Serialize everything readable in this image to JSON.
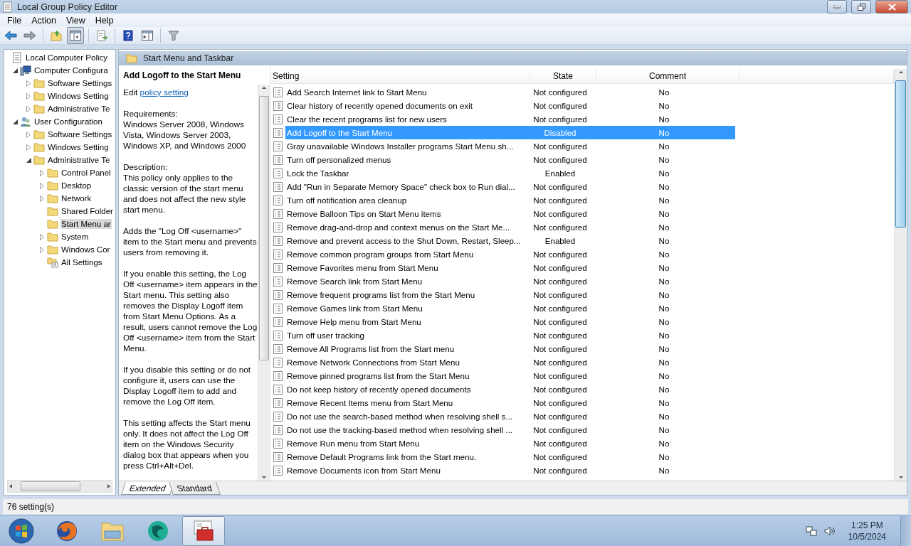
{
  "window": {
    "title": "Local Group Policy Editor"
  },
  "menu": [
    "File",
    "Action",
    "View",
    "Help"
  ],
  "toolbar": [
    {
      "kind": "back",
      "pressed": false
    },
    {
      "kind": "forward",
      "pressed": false
    },
    {
      "kind": "up",
      "pressed": false
    },
    {
      "kind": "tree",
      "pressed": true
    },
    {
      "kind": "export",
      "pressed": false
    },
    {
      "kind": "help",
      "pressed": false
    },
    {
      "kind": "action-pane",
      "pressed": false
    },
    {
      "kind": "filter",
      "pressed": false
    }
  ],
  "tree": [
    {
      "label": "Local Computer Policy",
      "kind": "policy",
      "selected": false,
      "children": [
        {
          "label": "Computer Configura",
          "kind": "computer",
          "selected": false,
          "expanded": true,
          "children": [
            {
              "label": "Software Settings",
              "kind": "folder",
              "selected": false,
              "expanded": false
            },
            {
              "label": "Windows Setting",
              "kind": "folder",
              "selected": false,
              "expanded": false
            },
            {
              "label": "Administrative Te",
              "kind": "folder",
              "selected": false,
              "expanded": false
            }
          ]
        },
        {
          "label": "User Configuration",
          "kind": "users",
          "selected": false,
          "expanded": true,
          "children": [
            {
              "label": "Software Settings",
              "kind": "folder",
              "selected": false,
              "expanded": false
            },
            {
              "label": "Windows Setting",
              "kind": "folder",
              "selected": false,
              "expanded": false
            },
            {
              "label": "Administrative Te",
              "kind": "folder",
              "selected": false,
              "expanded": true,
              "children": [
                {
                  "label": "Control Panel",
                  "kind": "folder",
                  "selected": false,
                  "expanded": false
                },
                {
                  "label": "Desktop",
                  "kind": "folder",
                  "selected": false,
                  "expanded": false
                },
                {
                  "label": "Network",
                  "kind": "folder",
                  "selected": false,
                  "expanded": false
                },
                {
                  "label": "Shared Folder",
                  "kind": "folder",
                  "selected": false
                },
                {
                  "label": "Start Menu ar",
                  "kind": "folder",
                  "selected": true
                },
                {
                  "label": "System",
                  "kind": "folder",
                  "selected": false,
                  "expanded": false
                },
                {
                  "label": "Windows Cor",
                  "kind": "folder",
                  "selected": false,
                  "expanded": false
                },
                {
                  "label": "All Settings",
                  "kind": "all-settings",
                  "selected": false
                }
              ]
            }
          ]
        }
      ]
    }
  ],
  "pane": {
    "title": "Start Menu and Taskbar"
  },
  "description": {
    "title": "Add Logoff to the Start Menu",
    "edit_prefix": "Edit",
    "edit_link": "policy setting",
    "blocks": [
      {
        "heading": "Requirements:",
        "text": "Windows Server 2008, Windows Vista, Windows Server 2003, Windows XP, and Windows 2000"
      },
      {
        "heading": "Description:",
        "text": "This policy only applies to the classic version of the start menu and does not affect the new style start menu."
      },
      {
        "text": "Adds the \"Log Off <username>\" item to the Start menu and prevents users from removing it."
      },
      {
        "text": "If you enable this setting, the Log Off <username> item appears in the Start menu. This setting also removes the Display Logoff item from Start Menu Options. As a result, users cannot remove the Log Off <username> item from the Start Menu."
      },
      {
        "text": "If you disable this setting or do not configure it, users can use the Display Logoff item to add and remove the Log Off item."
      },
      {
        "text": "This setting affects the Start menu only. It does not affect the Log Off item on the Windows Security dialog box that appears when you press Ctrl+Alt+Del."
      }
    ]
  },
  "table": {
    "columns": [
      "Setting",
      "State",
      "Comment"
    ],
    "rows": [
      {
        "setting": "Add Search Internet link to Start Menu",
        "state": "Not configured",
        "comment": "No",
        "selected": false
      },
      {
        "setting": "Clear history of recently opened documents on exit",
        "state": "Not configured",
        "comment": "No",
        "selected": false
      },
      {
        "setting": "Clear the recent programs list for new users",
        "state": "Not configured",
        "comment": "No",
        "selected": false
      },
      {
        "setting": "Add Logoff to the Start Menu",
        "state": "Disabled",
        "comment": "No",
        "selected": true
      },
      {
        "setting": "Gray unavailable Windows Installer programs Start Menu sh...",
        "state": "Not configured",
        "comment": "No",
        "selected": false
      },
      {
        "setting": "Turn off personalized menus",
        "state": "Not configured",
        "comment": "No",
        "selected": false
      },
      {
        "setting": "Lock the Taskbar",
        "state": "Enabled",
        "comment": "No",
        "selected": false
      },
      {
        "setting": "Add \"Run in Separate Memory Space\" check box to Run dial...",
        "state": "Not configured",
        "comment": "No",
        "selected": false
      },
      {
        "setting": "Turn off notification area cleanup",
        "state": "Not configured",
        "comment": "No",
        "selected": false
      },
      {
        "setting": "Remove Balloon Tips on Start Menu items",
        "state": "Not configured",
        "comment": "No",
        "selected": false
      },
      {
        "setting": "Remove drag-and-drop and context menus on the Start Me...",
        "state": "Not configured",
        "comment": "No",
        "selected": false
      },
      {
        "setting": "Remove and prevent access to the Shut Down, Restart, Sleep...",
        "state": "Enabled",
        "comment": "No",
        "selected": false
      },
      {
        "setting": "Remove common program groups from Start Menu",
        "state": "Not configured",
        "comment": "No",
        "selected": false
      },
      {
        "setting": "Remove Favorites menu from Start Menu",
        "state": "Not configured",
        "comment": "No",
        "selected": false
      },
      {
        "setting": "Remove Search link from Start Menu",
        "state": "Not configured",
        "comment": "No",
        "selected": false
      },
      {
        "setting": "Remove frequent programs list from the Start Menu",
        "state": "Not configured",
        "comment": "No",
        "selected": false
      },
      {
        "setting": "Remove Games link from Start Menu",
        "state": "Not configured",
        "comment": "No",
        "selected": false
      },
      {
        "setting": "Remove Help menu from Start Menu",
        "state": "Not configured",
        "comment": "No",
        "selected": false
      },
      {
        "setting": "Turn off user tracking",
        "state": "Not configured",
        "comment": "No",
        "selected": false
      },
      {
        "setting": "Remove All Programs list from the Start menu",
        "state": "Not configured",
        "comment": "No",
        "selected": false
      },
      {
        "setting": "Remove Network Connections from Start Menu",
        "state": "Not configured",
        "comment": "No",
        "selected": false
      },
      {
        "setting": "Remove pinned programs list from the Start Menu",
        "state": "Not configured",
        "comment": "No",
        "selected": false
      },
      {
        "setting": "Do not keep history of recently opened documents",
        "state": "Not configured",
        "comment": "No",
        "selected": false
      },
      {
        "setting": "Remove Recent Items menu from Start Menu",
        "state": "Not configured",
        "comment": "No",
        "selected": false
      },
      {
        "setting": "Do not use the search-based method when resolving shell s...",
        "state": "Not configured",
        "comment": "No",
        "selected": false
      },
      {
        "setting": "Do not use the tracking-based method when resolving shell ...",
        "state": "Not configured",
        "comment": "No",
        "selected": false
      },
      {
        "setting": "Remove Run menu from Start Menu",
        "state": "Not configured",
        "comment": "No",
        "selected": false
      },
      {
        "setting": "Remove Default Programs link from the Start menu.",
        "state": "Not configured",
        "comment": "No",
        "selected": false
      },
      {
        "setting": "Remove Documents icon from Start Menu",
        "state": "Not configured",
        "comment": "No",
        "selected": false
      }
    ]
  },
  "view_tabs": [
    {
      "label": "Extended",
      "selected": true
    },
    {
      "label": "Standard",
      "selected": false
    }
  ],
  "status_bar": "76 setting(s)",
  "taskbar": {
    "apps": [
      {
        "kind": "start",
        "active": false
      },
      {
        "kind": "firefox",
        "active": false
      },
      {
        "kind": "explorer",
        "active": false
      },
      {
        "kind": "globe",
        "active": false
      },
      {
        "kind": "toolbox",
        "active": true
      }
    ],
    "clock": {
      "time": "1:25 PM",
      "date": "10/5/2024"
    }
  }
}
